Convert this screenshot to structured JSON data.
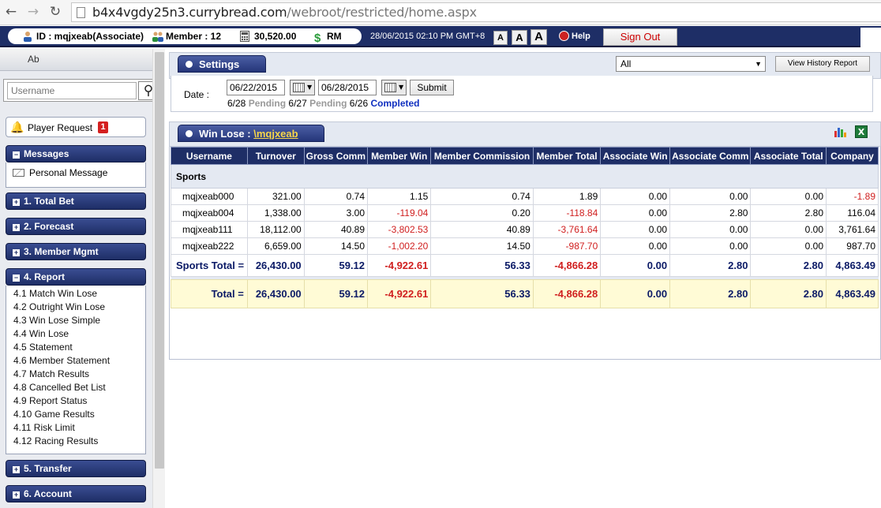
{
  "browser": {
    "url_host": "b4x4vgdy25n3.currybread.com",
    "url_path": "/webroot/restricted/home.aspx"
  },
  "topbar": {
    "id_label": "ID : mqjxeab(Associate)",
    "member_label": "Member : 12",
    "balance": "30,520.00",
    "currency": "RM",
    "datetime": "28/06/2015 02:10 PM GMT+8",
    "font_small": "A",
    "font_medium": "A",
    "font_large": "A",
    "help_label": "Help",
    "signout_label": "Sign Out"
  },
  "sidebar": {
    "tab_label": "Ab",
    "search_placeholder": "Username",
    "player_request_label": "Player Request",
    "player_request_count": "1",
    "messages": {
      "header": "Messages",
      "items": [
        "Personal Message"
      ]
    },
    "sections": [
      {
        "label": "1. Total Bet"
      },
      {
        "label": "2. Forecast"
      },
      {
        "label": "3. Member Mgmt"
      },
      {
        "label": "4. Report"
      },
      {
        "label": "5. Transfer"
      },
      {
        "label": "6. Account"
      }
    ],
    "report_items": [
      "4.1 Match Win Lose",
      "4.2 Outright Win Lose",
      "4.3 Win Lose Simple",
      "4.4 Win Lose",
      "4.5 Statement",
      "4.6 Member Statement",
      "4.7 Match Results",
      "4.8 Cancelled Bet List",
      "4.9 Report Status",
      "4.10 Game Results",
      "4.11 Risk Limit",
      "4.12 Racing Results"
    ]
  },
  "settings": {
    "title": "Settings",
    "filter_value": "All",
    "history_button": "View History Report",
    "date_label": "Date :",
    "date_from": "06/22/2015",
    "date_to": "06/28/2015",
    "submit_label": "Submit",
    "status": [
      {
        "date": "6/28",
        "state": "Pending"
      },
      {
        "date": "6/27",
        "state": "Pending"
      },
      {
        "date": "6/26",
        "state": "Completed"
      }
    ]
  },
  "winlose": {
    "title_prefix": "Win Lose : ",
    "title_link": "\\mqjxeab",
    "columns": [
      "Username",
      "Turnover",
      "Gross Comm",
      "Member Win",
      "Member Commission",
      "Member Total",
      "Associate Win",
      "Associate Comm",
      "Associate Total",
      "Company"
    ],
    "group_label": "Sports",
    "rows": [
      {
        "username": "mqjxeab000",
        "turnover": "321.00",
        "gross_comm": "0.74",
        "member_win": "1.15",
        "member_commission": "0.74",
        "member_total": "1.89",
        "associate_win": "0.00",
        "associate_comm": "0.00",
        "associate_total": "0.00",
        "company": "-1.89"
      },
      {
        "username": "mqjxeab004",
        "turnover": "1,338.00",
        "gross_comm": "3.00",
        "member_win": "-119.04",
        "member_commission": "0.20",
        "member_total": "-118.84",
        "associate_win": "0.00",
        "associate_comm": "2.80",
        "associate_total": "2.80",
        "company": "116.04"
      },
      {
        "username": "mqjxeab111",
        "turnover": "18,112.00",
        "gross_comm": "40.89",
        "member_win": "-3,802.53",
        "member_commission": "40.89",
        "member_total": "-3,761.64",
        "associate_win": "0.00",
        "associate_comm": "0.00",
        "associate_total": "0.00",
        "company": "3,761.64"
      },
      {
        "username": "mqjxeab222",
        "turnover": "6,659.00",
        "gross_comm": "14.50",
        "member_win": "-1,002.20",
        "member_commission": "14.50",
        "member_total": "-987.70",
        "associate_win": "0.00",
        "associate_comm": "0.00",
        "associate_total": "0.00",
        "company": "987.70"
      }
    ],
    "sports_total": {
      "label": "Sports Total =",
      "turnover": "26,430.00",
      "gross_comm": "59.12",
      "member_win": "-4,922.61",
      "member_commission": "56.33",
      "member_total": "-4,866.28",
      "associate_win": "0.00",
      "associate_comm": "2.80",
      "associate_total": "2.80",
      "company": "4,863.49"
    },
    "grand_total": {
      "label": "Total =",
      "turnover": "26,430.00",
      "gross_comm": "59.12",
      "member_win": "-4,922.61",
      "member_commission": "56.33",
      "member_total": "-4,866.28",
      "associate_win": "0.00",
      "associate_comm": "2.80",
      "associate_total": "2.80",
      "company": "4,863.49"
    }
  },
  "colors": {
    "navy": "#1e2e66",
    "negative": "#d01f1f",
    "completed": "#1030c0",
    "total_bg": "#fffbd6"
  }
}
